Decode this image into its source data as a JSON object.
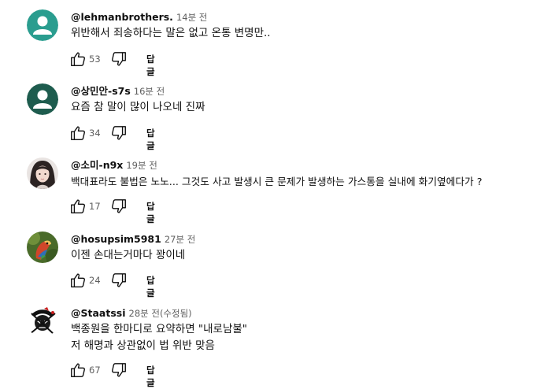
{
  "comments": [
    {
      "author": "@lehmanbrothers.",
      "time": "14분 전",
      "lines": [
        "위반해서 죄송하다는 말은 없고 온통 변명만.."
      ],
      "likes": "53",
      "reply_label": "답글",
      "avatar": {
        "type": "default-person",
        "color": "#2a9d8f"
      }
    },
    {
      "author": "@상민안-s7s",
      "time": "16분 전",
      "lines": [
        "요즘 참 말이 많이 나오네 진짜"
      ],
      "likes": "34",
      "reply_label": "답글",
      "avatar": {
        "type": "default-person",
        "color": "#1e5c4e"
      }
    },
    {
      "author": "@소미-n9x",
      "time": "19분 전",
      "lines": [
        "백대표라도 불법은 노노... 그것도 사고 발생시 큰 문제가 발생하는 가스통을 실내에 화기옆에다가 ?"
      ],
      "likes": "17",
      "reply_label": "답글",
      "avatar": {
        "type": "photo-girl"
      }
    },
    {
      "author": "@hosupsim5981",
      "time": "27분 전",
      "lines": [
        "이젠 손대는거마다 꽝이네"
      ],
      "likes": "24",
      "reply_label": "답글",
      "avatar": {
        "type": "photo-parrot"
      }
    },
    {
      "author": "@Staatssi",
      "time": "28분 전(수정됨)",
      "lines": [
        "백종원을 한마디로 요약하면 \"내로남불\"",
        "저 해명과 상관없이 법 위반 맞음"
      ],
      "likes": "67",
      "reply_label": "답글",
      "avatar": {
        "type": "photo-pirate"
      }
    }
  ],
  "colors": {
    "text": "#0f0f0f",
    "secondary": "#606060"
  }
}
